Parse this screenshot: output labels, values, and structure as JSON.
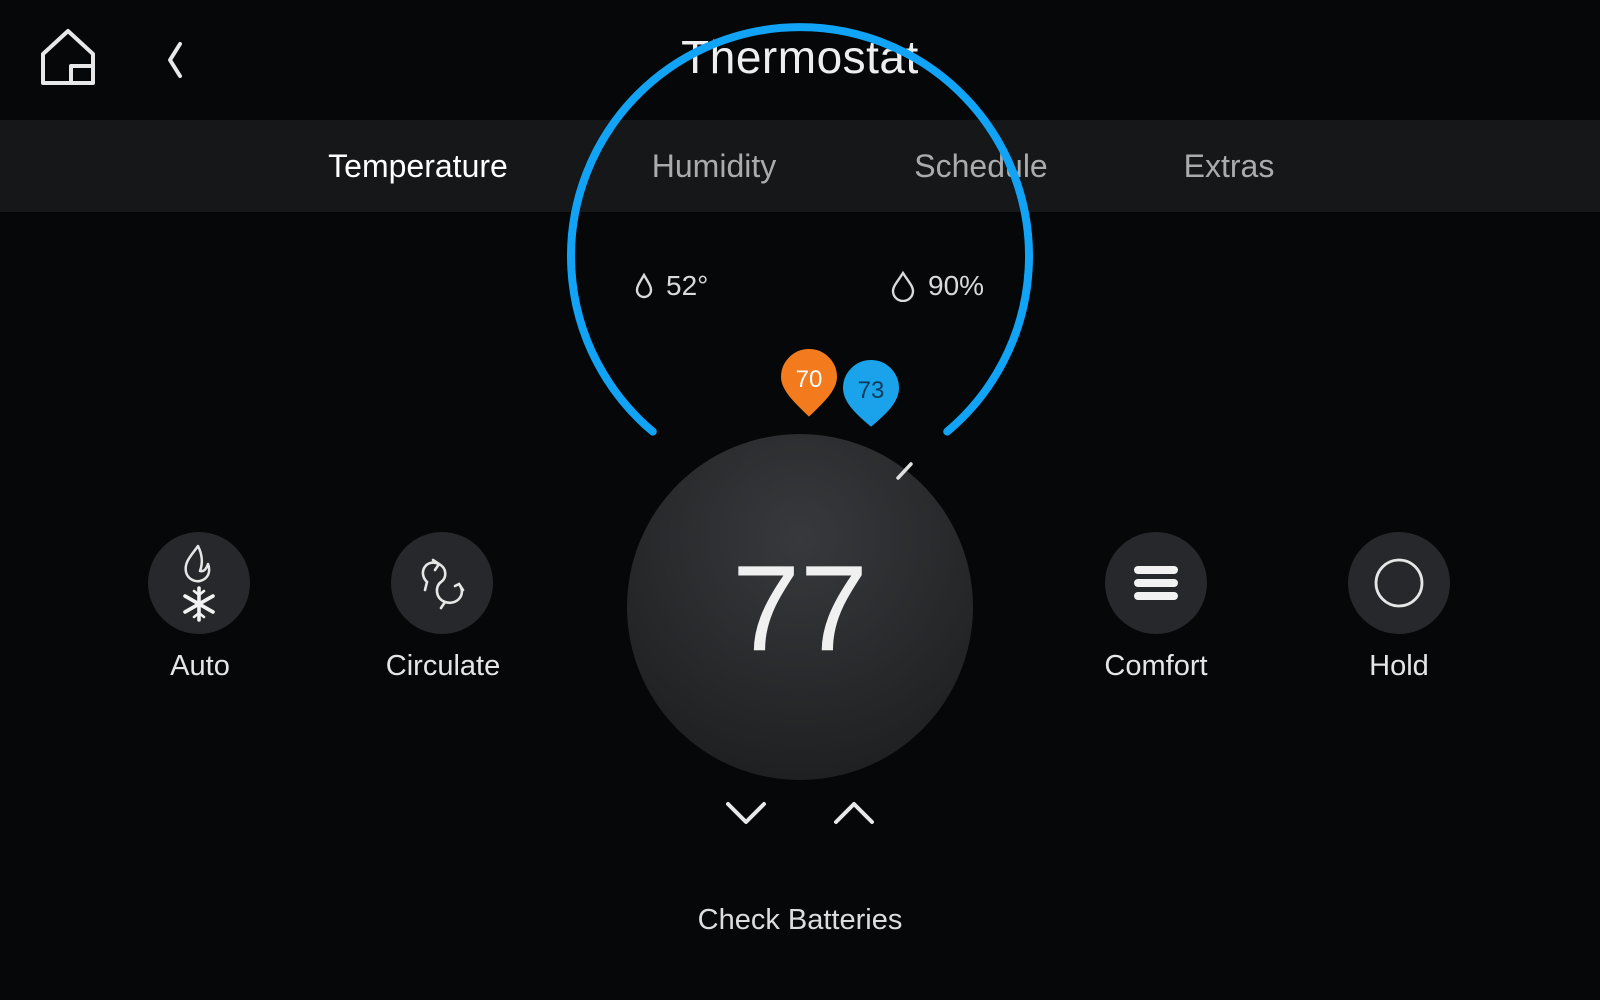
{
  "header": {
    "title": "Thermostat",
    "home_icon": "home-icon",
    "back_icon": "chevron-left-icon"
  },
  "tabs": [
    {
      "label": "Temperature",
      "active": true
    },
    {
      "label": "Humidity",
      "active": false
    },
    {
      "label": "Schedule",
      "active": false
    },
    {
      "label": "Extras",
      "active": false
    }
  ],
  "readouts": {
    "dew_point": {
      "icon": "droplet-small-icon",
      "value": "52°"
    },
    "humidity": {
      "icon": "droplet-icon",
      "value": "90%"
    }
  },
  "modes": {
    "system": {
      "label": "Auto",
      "icon": "flame-snowflake-icon"
    },
    "fan": {
      "label": "Circulate",
      "icon": "circulate-icon"
    },
    "profile": {
      "label": "Comfort",
      "icon": "menu-lines-icon"
    },
    "hold": {
      "label": "Hold",
      "icon": "circle-icon"
    }
  },
  "dial": {
    "current_temp": "77",
    "heat_setpoint": "70",
    "cool_setpoint": "73",
    "heat_color": "#f47a1e",
    "cool_color": "#1aa3ea",
    "ring_color": "#11a3f5",
    "decrease_icon": "chevron-down-icon",
    "increase_icon": "chevron-up-icon"
  },
  "status": {
    "message": "Check Batteries"
  }
}
